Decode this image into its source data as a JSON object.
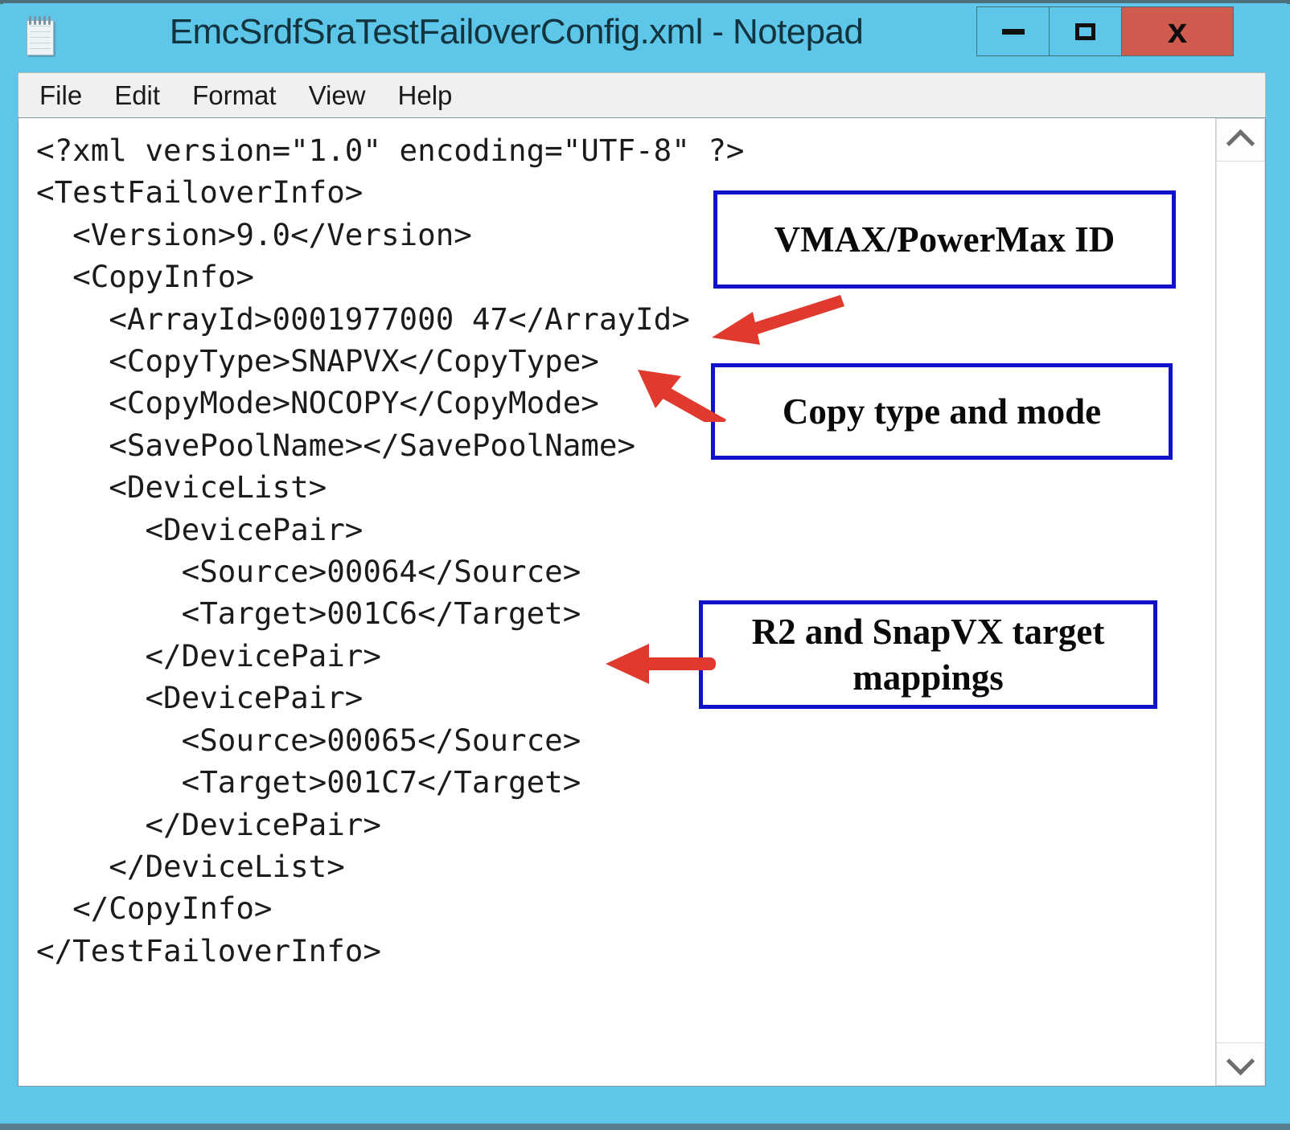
{
  "window": {
    "title": "EmcSrdfSraTestFailoverConfig.xml - Notepad",
    "icon": "notepad-icon",
    "controls": {
      "minimize": "—",
      "maximize": "□",
      "close": "x"
    },
    "colors": {
      "titlebar": "#5ec6e8",
      "close_button": "#cf5b4e",
      "annotation_border": "#1111c9",
      "arrow": "#e03a2f",
      "menubar": "#f0f0f0",
      "editor_background": "#ffffff",
      "text": "#1b1b1b"
    }
  },
  "menu": {
    "items": [
      {
        "label": "File"
      },
      {
        "label": "Edit"
      },
      {
        "label": "Format"
      },
      {
        "label": "View"
      },
      {
        "label": "Help"
      }
    ]
  },
  "editor": {
    "content": "<?xml version=\"1.0\" encoding=\"UTF-8\" ?>\n<TestFailoverInfo>\n  <Version>9.0</Version>\n  <CopyInfo>\n    <ArrayId>0001977000 47</ArrayId>\n    <CopyType>SNAPVX</CopyType>\n    <CopyMode>NOCOPY</CopyMode>\n    <SavePoolName></SavePoolName>\n    <DeviceList>\n      <DevicePair>\n        <Source>00064</Source>\n        <Target>001C6</Target>\n      </DevicePair>\n      <DevicePair>\n        <Source>00065</Source>\n        <Target>001C7</Target>\n      </DevicePair>\n    </DeviceList>\n  </CopyInfo>\n</TestFailoverInfo>",
    "xml": {
      "declaration": "<?xml version=\"1.0\" encoding=\"UTF-8\" ?>",
      "root": "TestFailoverInfo",
      "version": "9.0",
      "array_id": "0001977000 47",
      "copy_type": "SNAPVX",
      "copy_mode": "NOCOPY",
      "save_pool_name": "",
      "device_pairs": [
        {
          "source": "00064",
          "target": "001C6"
        },
        {
          "source": "00065",
          "target": "001C7"
        }
      ]
    }
  },
  "scrollbar": {
    "up_arrow": "chevron-up",
    "down_arrow": "chevron-down"
  },
  "annotations": [
    {
      "id": "anno-1",
      "text": "VMAX/PowerMax ID",
      "points_to": "ArrayId value"
    },
    {
      "id": "anno-2",
      "text": "Copy type and mode",
      "points_to": "CopyType and CopyMode elements"
    },
    {
      "id": "anno-3",
      "text": "R2 and SnapVX target mappings",
      "points_to": "DevicePair elements"
    }
  ]
}
